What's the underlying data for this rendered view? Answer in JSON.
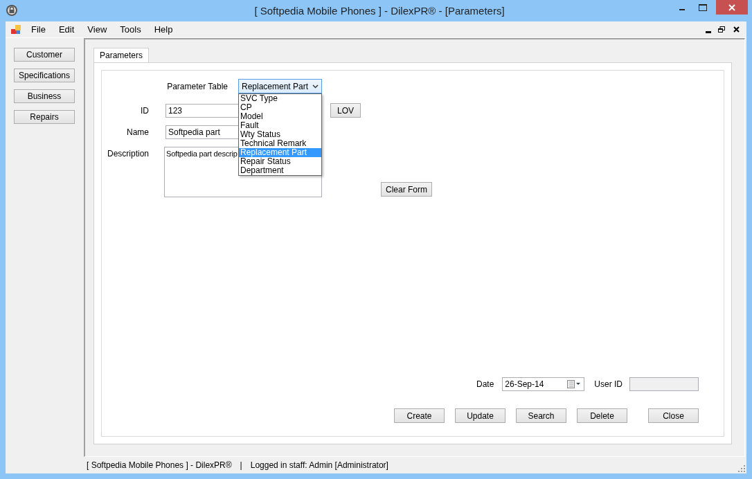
{
  "window": {
    "title": "[ Softpedia Mobile Phones ] - DilexPR® - [Parameters]"
  },
  "menu": [
    "File",
    "Edit",
    "View",
    "Tools",
    "Help"
  ],
  "sidebar": {
    "buttons": [
      "Customer",
      "Specifications",
      "Business",
      "Repairs"
    ]
  },
  "tabs": [
    {
      "label": "Parameters",
      "selected": true
    }
  ],
  "form": {
    "parameter_table": {
      "label": "Parameter Table",
      "value": "Replacement Part",
      "expanded": true,
      "options": [
        {
          "label": "SVC Type",
          "selected": false
        },
        {
          "label": "CP",
          "selected": false
        },
        {
          "label": "Model",
          "selected": false
        },
        {
          "label": "Fault",
          "selected": false
        },
        {
          "label": "Wty Status",
          "selected": false
        },
        {
          "label": "Technical Remark",
          "selected": false
        },
        {
          "label": "Replacement Part",
          "selected": true
        },
        {
          "label": "Repair Status",
          "selected": false
        },
        {
          "label": "Department",
          "selected": false
        }
      ]
    },
    "id": {
      "label": "ID",
      "value": "123"
    },
    "lov_button": "LOV",
    "name": {
      "label": "Name",
      "value": "Softpedia part"
    },
    "description": {
      "label": "Description",
      "value": "Softpedia part descrip"
    },
    "clear_button": "Clear Form",
    "date": {
      "label": "Date",
      "value": "26-Sep-14"
    },
    "user_id": {
      "label": "User ID",
      "disabled": true
    },
    "buttons": [
      "Create",
      "Update",
      "Search",
      "Delete",
      "Close"
    ]
  },
  "status_bar": {
    "app": "[ Softpedia Mobile Phones ] - DilexPR®",
    "separator": "|",
    "user": "Logged in staff: Admin [Administrator]"
  }
}
